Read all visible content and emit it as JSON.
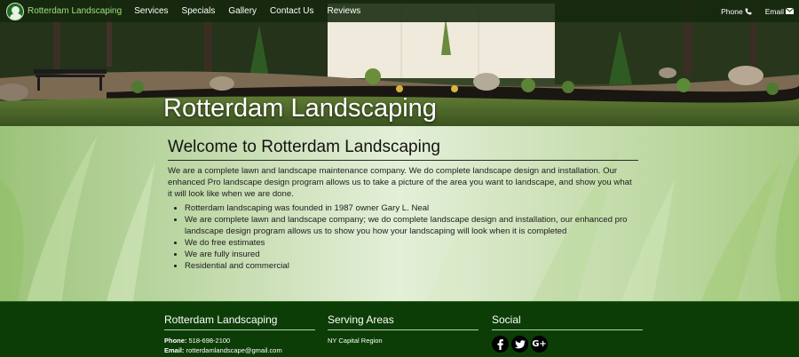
{
  "nav": {
    "brand": "Rotterdam Landscaping",
    "items": [
      "Services",
      "Specials",
      "Gallery",
      "Contact Us",
      "Reviews"
    ],
    "phone_label": "Phone",
    "email_label": "Email"
  },
  "hero": {
    "title": "Rotterdam Landscaping"
  },
  "main": {
    "heading": "Welcome to Rotterdam Landscaping",
    "intro": "We are a complete lawn and landscape maintenance company. We do complete landscape design and installation. Our enhanced Pro landscape design program allows us to take a picture of the area you want to landscape, and show you what it will look like when we are done.",
    "bullets": [
      "Rotterdam landscaping was founded in 1987 owner Gary L. Neal",
      "We are complete lawn and landscape company; we do complete landscape design and installation, our enhanced pro landscape design program allows us to show you how your landscaping will look when it is completed",
      "We do free estimates",
      "We are fully insured",
      "Residential and commercial"
    ]
  },
  "footer": {
    "col1": {
      "title": "Rotterdam Landscaping",
      "phone_label": "Phone:",
      "phone": "518-698-2100",
      "email_label": "Email:",
      "email": "rotterdamlandscape@gmail.com"
    },
    "col2": {
      "title": "Serving Areas",
      "area": "NY Capital Region"
    },
    "col3": {
      "title": "Social",
      "icons": [
        "facebook-icon",
        "twitter-icon",
        "google-plus-icon"
      ]
    }
  },
  "colors": {
    "nav_bg": "#14280c",
    "brand_green": "#9ee07c",
    "footer_bg": "#0c3d06"
  }
}
